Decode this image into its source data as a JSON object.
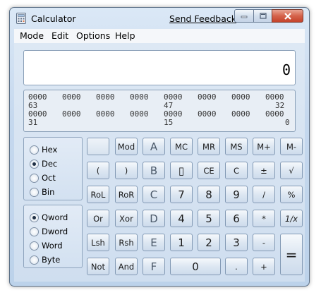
{
  "window": {
    "title": "Calculator",
    "feedback_link": "Send Feedback",
    "caption_icons": [
      "minimize-icon",
      "maximize-icon",
      "close-icon"
    ]
  },
  "menu": [
    "Mode",
    "Edit",
    "Options",
    "Help"
  ],
  "display": {
    "value": "0"
  },
  "bits": {
    "row1": [
      "0000",
      "0000",
      "0000",
      "0000",
      "0000",
      "0000",
      "0000",
      "0000"
    ],
    "row1_labels": [
      "63",
      "47",
      "32"
    ],
    "row2": [
      "0000",
      "0000",
      "0000",
      "0000",
      "0000",
      "0000",
      "0000",
      "0000"
    ],
    "row2_labels": [
      "31",
      "15",
      "0"
    ]
  },
  "base": {
    "options": [
      "Hex",
      "Dec",
      "Oct",
      "Bin"
    ],
    "selected": "Dec"
  },
  "word_size": {
    "options": [
      "Qword",
      "Dword",
      "Word",
      "Byte"
    ],
    "selected": "Qword"
  },
  "keys": [
    [
      "",
      "Mod",
      "A",
      "MC",
      "MR",
      "MS",
      "M+",
      "M-"
    ],
    [
      "(",
      ")",
      "B",
      "▯",
      "CE",
      "C",
      "±",
      "√"
    ],
    [
      "RoL",
      "RoR",
      "C",
      "7",
      "8",
      "9",
      "/",
      "%"
    ],
    [
      "Or",
      "Xor",
      "D",
      "4",
      "5",
      "6",
      "*",
      "1/x"
    ],
    [
      "Lsh",
      "Rsh",
      "E",
      "1",
      "2",
      "3",
      "-",
      "="
    ],
    [
      "Not",
      "And",
      "F",
      "0",
      ".",
      "+"
    ]
  ],
  "colors": {
    "window_frame": "#c5d8ee",
    "close_button": "#d5634b",
    "display_bg": "#ffffff"
  }
}
